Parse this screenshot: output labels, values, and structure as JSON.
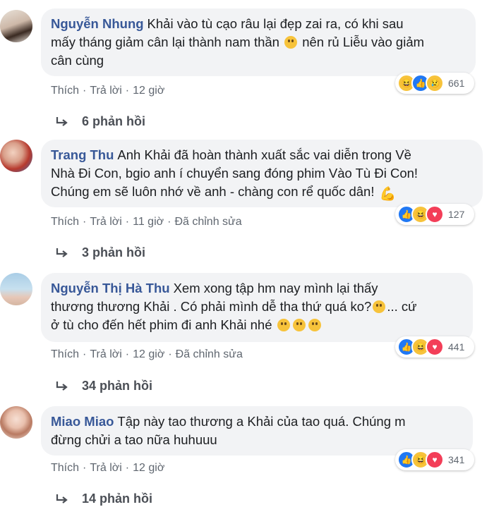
{
  "comments": [
    {
      "name": "Nguyễn Nhung",
      "lines": [
        "Khải vào tù cạo râu lại đẹp zai ra, có khi sau",
        "mấy tháng giảm cân lại thành nam thần",
        "nên rủ Liễu vào giảm",
        "cân cùng"
      ],
      "actions": {
        "like": "Thích",
        "reply": "Trả lời",
        "time": "12 giờ",
        "edited": ""
      },
      "reactions": [
        "haha",
        "like",
        "sad"
      ],
      "reaction_count": "661",
      "replies": "6 phản hồi"
    },
    {
      "name": "Trang Thu",
      "lines": [
        "Anh Khải đã hoàn thành xuất sắc vai diễn trong Về",
        "Nhà Đi Con, bgio anh í chuyển sang đóng phim Vào Tù Đi Con!",
        "Chúng em sẽ luôn nhớ về anh - chàng con rể quốc dân!"
      ],
      "actions": {
        "like": "Thích",
        "reply": "Trả lời",
        "time": "11 giờ",
        "edited": "Đã chỉnh sửa"
      },
      "reactions": [
        "like",
        "haha",
        "love"
      ],
      "reaction_count": "127",
      "replies": "3 phản hồi"
    },
    {
      "name": "Nguyễn Thị Hà Thu",
      "lines": [
        "Xem xong tập hm nay mình lại thấy",
        "thương thương Khải . Có phải mình dễ tha thứ quá ko?",
        "... cứ",
        "ở tù cho đến hết phim đi anh Khải nhé"
      ],
      "actions": {
        "like": "Thích",
        "reply": "Trả lời",
        "time": "12 giờ",
        "edited": "Đã chỉnh sửa"
      },
      "reactions": [
        "like",
        "haha",
        "love"
      ],
      "reaction_count": "441",
      "replies": "34 phản hồi"
    },
    {
      "name": "Miao Miao",
      "lines": [
        "Tập này tao thương a Khải của tao quá. Chúng m",
        "đừng chửi a tao nữa huhuuu"
      ],
      "actions": {
        "like": "Thích",
        "reply": "Trả lời",
        "time": "12 giờ",
        "edited": ""
      },
      "reactions": [
        "like",
        "haha",
        "love"
      ],
      "reaction_count": "341",
      "replies": "14 phản hồi"
    }
  ],
  "colors": {
    "name": "#385898",
    "bubble": "#f2f3f5",
    "meta": "#606770",
    "like": "#2078f4",
    "love": "#f33e58",
    "haha": "#f7c33b"
  }
}
